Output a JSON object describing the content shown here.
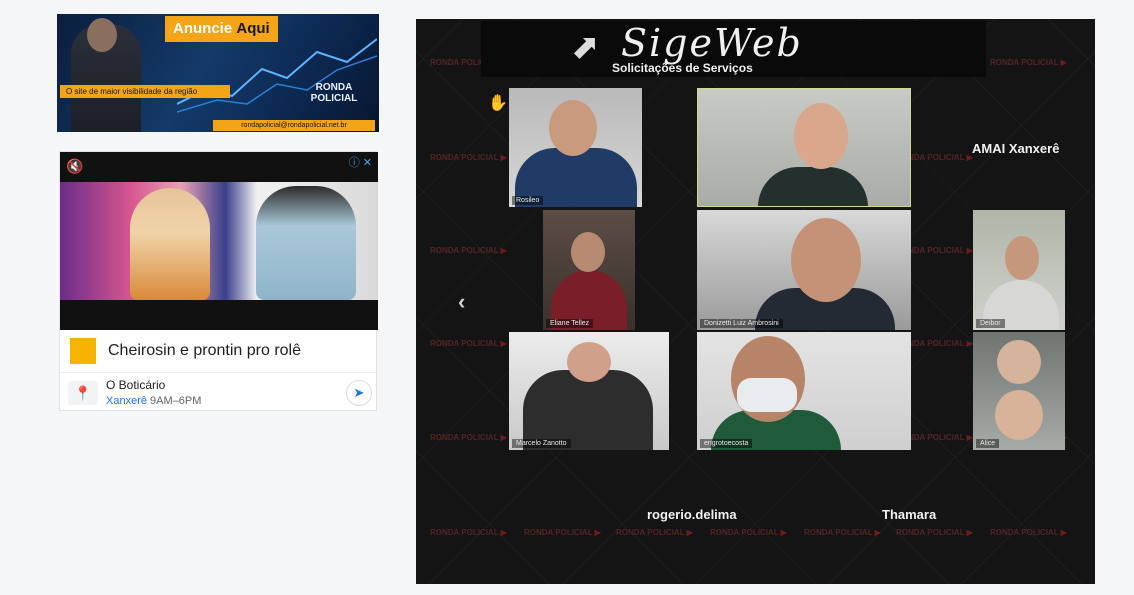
{
  "banner": {
    "tag_left": "Anuncie",
    "tag_right": "Aqui",
    "slogan": "O site de maior visibilidade da região",
    "logo_top": "RONDA",
    "logo_bottom": "POLICIAL",
    "url": "rondapolicial@rondapolicial.net.br"
  },
  "ad": {
    "headline": "Cheirosin e prontin pro rolê",
    "brand": "O Boticário",
    "city": "Xanxerê",
    "hours": "9AM–6PM",
    "adchoices": "ⓘ ✕"
  },
  "meeting": {
    "title": "SigeWeb",
    "subtitle": "Solicitações de Serviços",
    "watermark": "RONDA POLICIAL",
    "labels": {
      "amai": "AMAI Xanxerê",
      "rogerio": "rogerio.delima",
      "thamara": "Thamara"
    },
    "participants": [
      "Rosileo",
      "Eliane Tellez",
      "Donizetti Luiz Ambrosini",
      "Deibor",
      "Marcelo Zanotto",
      "engrotoecosta",
      "Alice"
    ]
  },
  "icons": {
    "mute": "mute-icon",
    "raise_hand": "raise-hand-icon",
    "prev": "chevron-left-icon",
    "directions": "directions-icon",
    "location": "location-pin-icon"
  }
}
